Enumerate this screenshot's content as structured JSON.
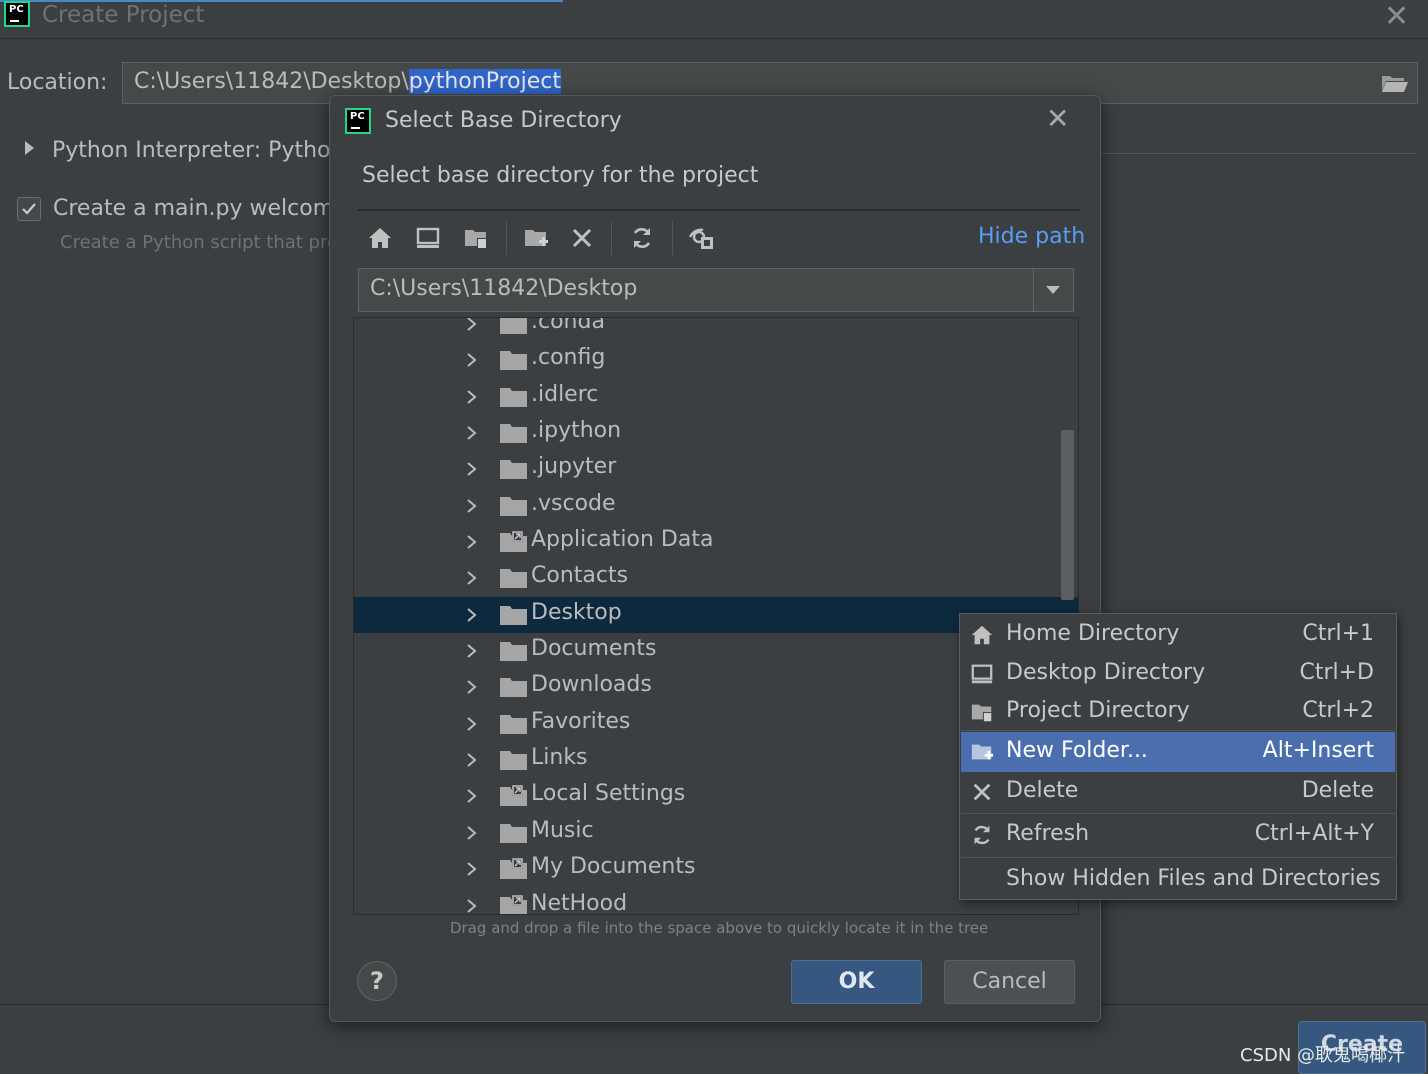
{
  "window": {
    "title": "Create Project",
    "location_label": "Location:",
    "location_prefix": "C:\\Users\\11842\\Desktop\\",
    "location_selected": "pythonProject",
    "interpreter_label": "Python Interpreter: Python",
    "create_main_label": "Create a main.py welcome",
    "create_main_desc": "Create a Python script that pro",
    "create_main_checked": true,
    "create_button": "Create"
  },
  "dialog": {
    "title": "Select Base Directory",
    "description": "Select base directory for the project",
    "toolbar": {
      "icons": [
        "home-icon",
        "desktop-icon",
        "project-directory-icon",
        "new-folder-icon",
        "delete-icon",
        "refresh-icon",
        "show-hidden-icon"
      ],
      "hide_path": "Hide path"
    },
    "path": "C:\\Users\\11842\\Desktop",
    "tree": [
      {
        "label": ".conda",
        "linked": false,
        "selected": false
      },
      {
        "label": ".config",
        "linked": false,
        "selected": false
      },
      {
        "label": ".idlerc",
        "linked": false,
        "selected": false
      },
      {
        "label": ".ipython",
        "linked": false,
        "selected": false
      },
      {
        "label": ".jupyter",
        "linked": false,
        "selected": false
      },
      {
        "label": ".vscode",
        "linked": false,
        "selected": false
      },
      {
        "label": "Application Data",
        "linked": true,
        "selected": false
      },
      {
        "label": "Contacts",
        "linked": false,
        "selected": false
      },
      {
        "label": "Desktop",
        "linked": false,
        "selected": true
      },
      {
        "label": "Documents",
        "linked": false,
        "selected": false
      },
      {
        "label": "Downloads",
        "linked": false,
        "selected": false
      },
      {
        "label": "Favorites",
        "linked": false,
        "selected": false
      },
      {
        "label": "Links",
        "linked": false,
        "selected": false
      },
      {
        "label": "Local Settings",
        "linked": true,
        "selected": false
      },
      {
        "label": "Music",
        "linked": false,
        "selected": false
      },
      {
        "label": "My Documents",
        "linked": true,
        "selected": false
      },
      {
        "label": "NetHood",
        "linked": true,
        "selected": false
      }
    ],
    "drop_hint": "Drag and drop a file into the space above to quickly locate it in the tree",
    "help": "?",
    "ok": "OK",
    "cancel": "Cancel"
  },
  "context_menu": [
    {
      "label": "Home Directory",
      "shortcut": "Ctrl+1",
      "icon": "home-icon",
      "highlighted": false
    },
    {
      "label": "Desktop Directory",
      "shortcut": "Ctrl+D",
      "icon": "desktop-icon",
      "highlighted": false
    },
    {
      "label": "Project Directory",
      "shortcut": "Ctrl+2",
      "icon": "project-directory-icon",
      "highlighted": false
    },
    {
      "label": "New Folder...",
      "shortcut": "Alt+Insert",
      "icon": "new-folder-icon",
      "highlighted": true
    },
    {
      "label": "Delete",
      "shortcut": "Delete",
      "icon": "delete-icon",
      "highlighted": false
    },
    {
      "label": "Refresh",
      "shortcut": "Ctrl+Alt+Y",
      "icon": "refresh-icon",
      "highlighted": false
    },
    {
      "label": "Show Hidden Files and Directories",
      "shortcut": "",
      "icon": "",
      "highlighted": false
    }
  ],
  "watermark": "CSDN @耿鬼喝椰汁",
  "colors": {
    "background": "#3c3f41",
    "selection": "#0d293e",
    "menu_highlight": "#4b6eaf",
    "link": "#589df6",
    "primary_button": "#365880"
  }
}
